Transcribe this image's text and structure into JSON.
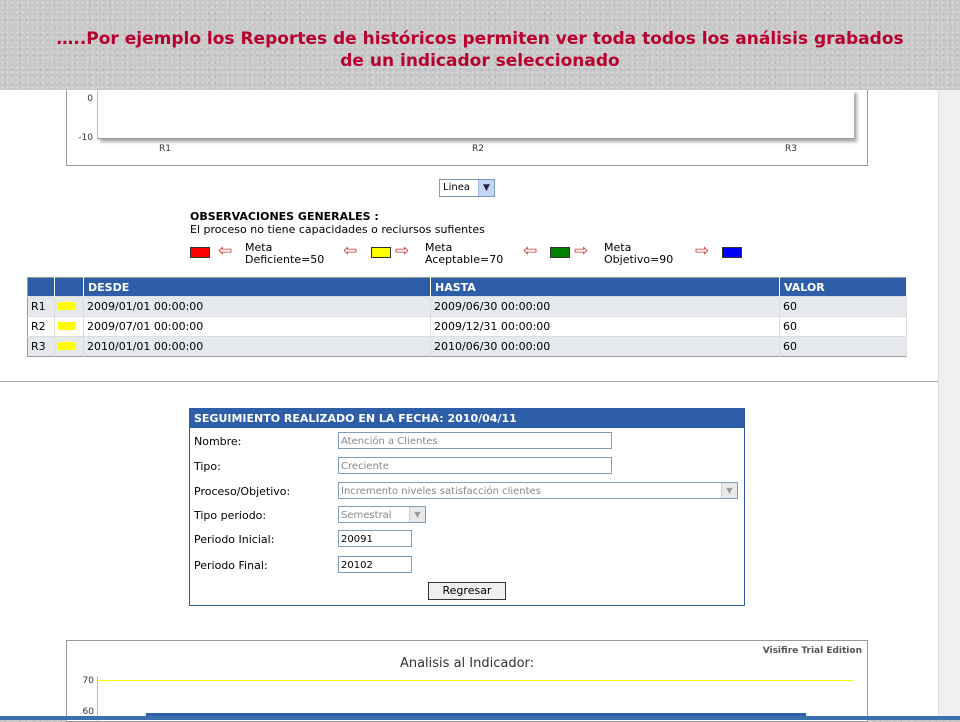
{
  "slide_title_line1": "…..Por ejemplo los Reportes de históricos permiten ver toda todos los análisis grabados",
  "slide_title_line2": "de un indicador seleccionado",
  "top_chart": {
    "y_ticks": [
      "0",
      "-10"
    ],
    "x_ticks": [
      "R1",
      "R2",
      "R3"
    ]
  },
  "chart_type_select": {
    "value": "Linea"
  },
  "observations": {
    "title": "OBSERVACIONES GENERALES :",
    "text": "El proceso no tiene capacidades o reciursos sufientes",
    "legend": [
      {
        "label1": "Meta",
        "label2": "Deficiente=50",
        "color": "#ff0000"
      },
      {
        "label1": "Meta",
        "label2": "Aceptable=70",
        "color": "#ffff00"
      },
      {
        "label1": "Meta",
        "label2": "Objetivo=90",
        "color": "#008000"
      }
    ],
    "end_color": "#0000ff"
  },
  "table": {
    "headers": [
      "",
      "",
      "DESDE",
      "HASTA",
      "VALOR"
    ],
    "rows": [
      {
        "id": "R1",
        "desde": "2009/01/01 00:00:00",
        "hasta": "2009/06/30 00:00:00",
        "valor": "60"
      },
      {
        "id": "R2",
        "desde": "2009/07/01 00:00:00",
        "hasta": "2009/12/31 00:00:00",
        "valor": "60"
      },
      {
        "id": "R3",
        "desde": "2010/01/01 00:00:00",
        "hasta": "2010/06/30 00:00:00",
        "valor": "60"
      }
    ]
  },
  "form": {
    "header": "SEGUIMIENTO REALIZADO EN LA FECHA: 2010/04/11",
    "nombre_label": "Nombre:",
    "nombre_value": "Atención a Clientes",
    "tipo_label": "Tipo:",
    "tipo_value": "Creciente",
    "proceso_label": "Proceso/Objetivo:",
    "proceso_value": "Incremento niveles satisfacción clientes",
    "periodo_label": "Tipo periodo:",
    "periodo_value": "Semestral",
    "inicial_label": "Periodo Inicial:",
    "inicial_value": "20091",
    "final_label": "Periodo Final:",
    "final_value": "20102",
    "back_button": "Regresar"
  },
  "bottom_chart": {
    "title": "Analisis al Indicador:",
    "trial_text": "Visifire Trial Edition",
    "y_ticks": [
      "70",
      "60"
    ]
  }
}
